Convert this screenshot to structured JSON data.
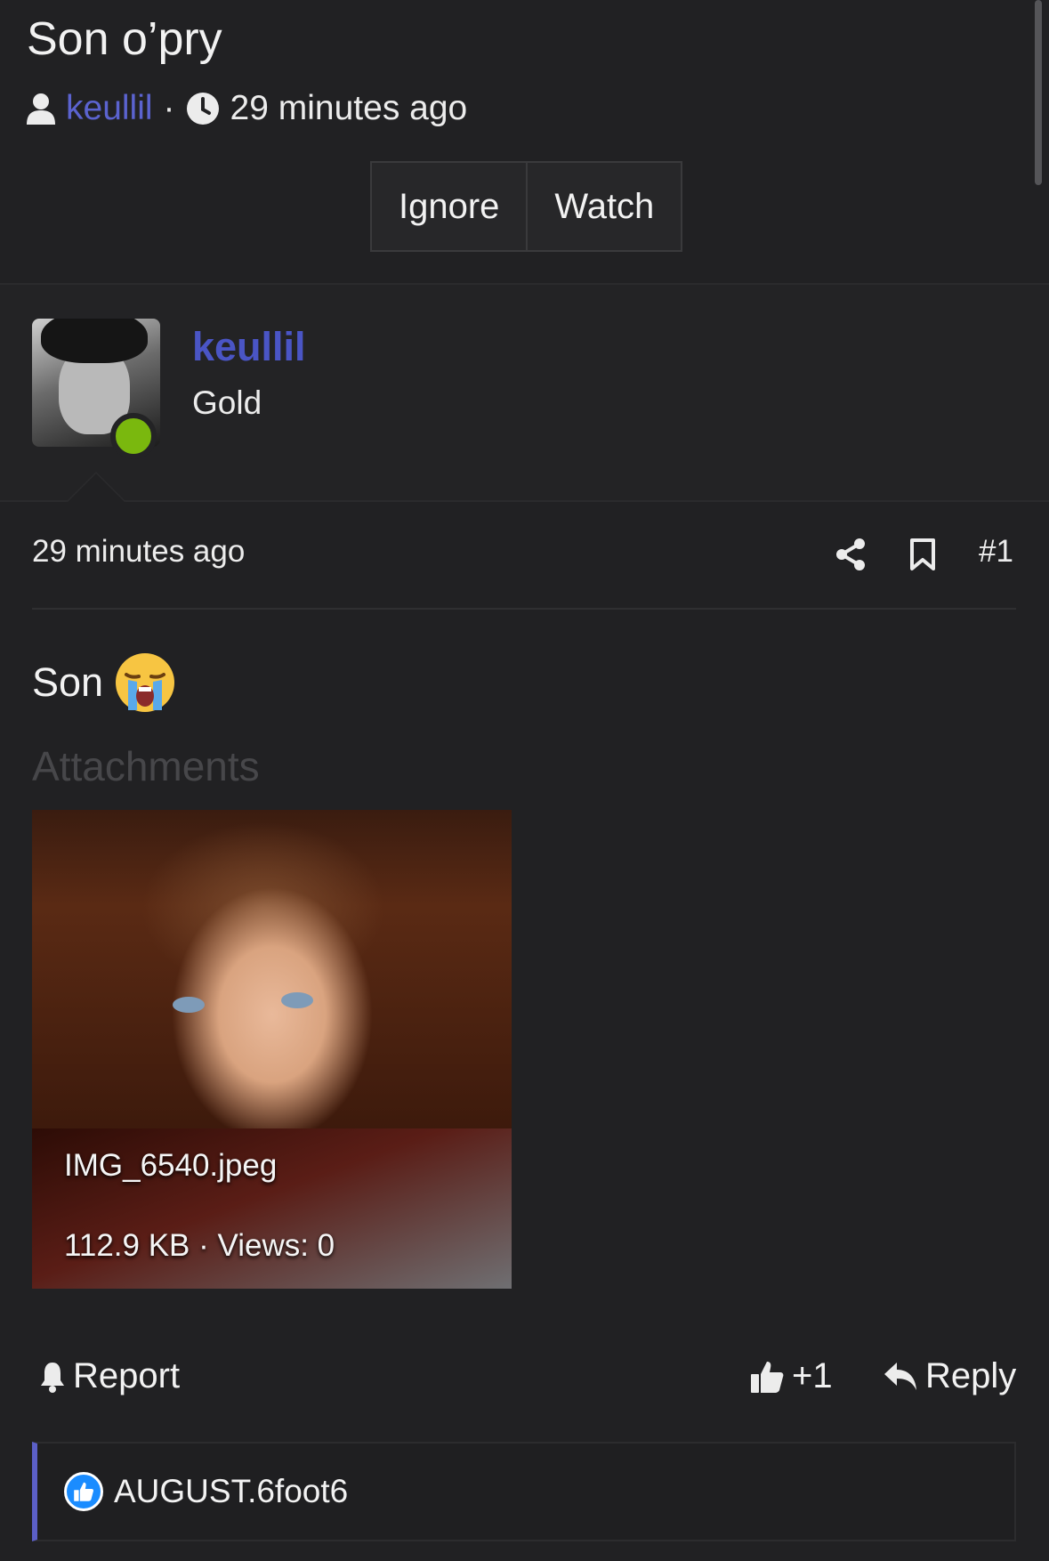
{
  "thread": {
    "title": "Son o’pry",
    "author": "keullil",
    "separator": "·",
    "time_ago": "29 minutes ago",
    "ignore_label": "Ignore",
    "watch_label": "Watch"
  },
  "post": {
    "author_name": "keullil",
    "author_rank": "Gold",
    "time_ago": "29 minutes ago",
    "number": "#1",
    "body_text": "Son",
    "body_emoji": "crying-face-emoji",
    "attachments_title": "Attachments",
    "attachment": {
      "file_name": "IMG_6540.jpeg",
      "file_meta": "112.9 KB · Views: 0"
    },
    "report_label": "Report",
    "like_label": "+1",
    "reply_label": "Reply"
  },
  "reactions": {
    "user": "AUGUST.6foot6"
  },
  "colors": {
    "accent": "#5b63cf",
    "online": "#7ab80e",
    "reaction_like": "#1a8cff"
  }
}
